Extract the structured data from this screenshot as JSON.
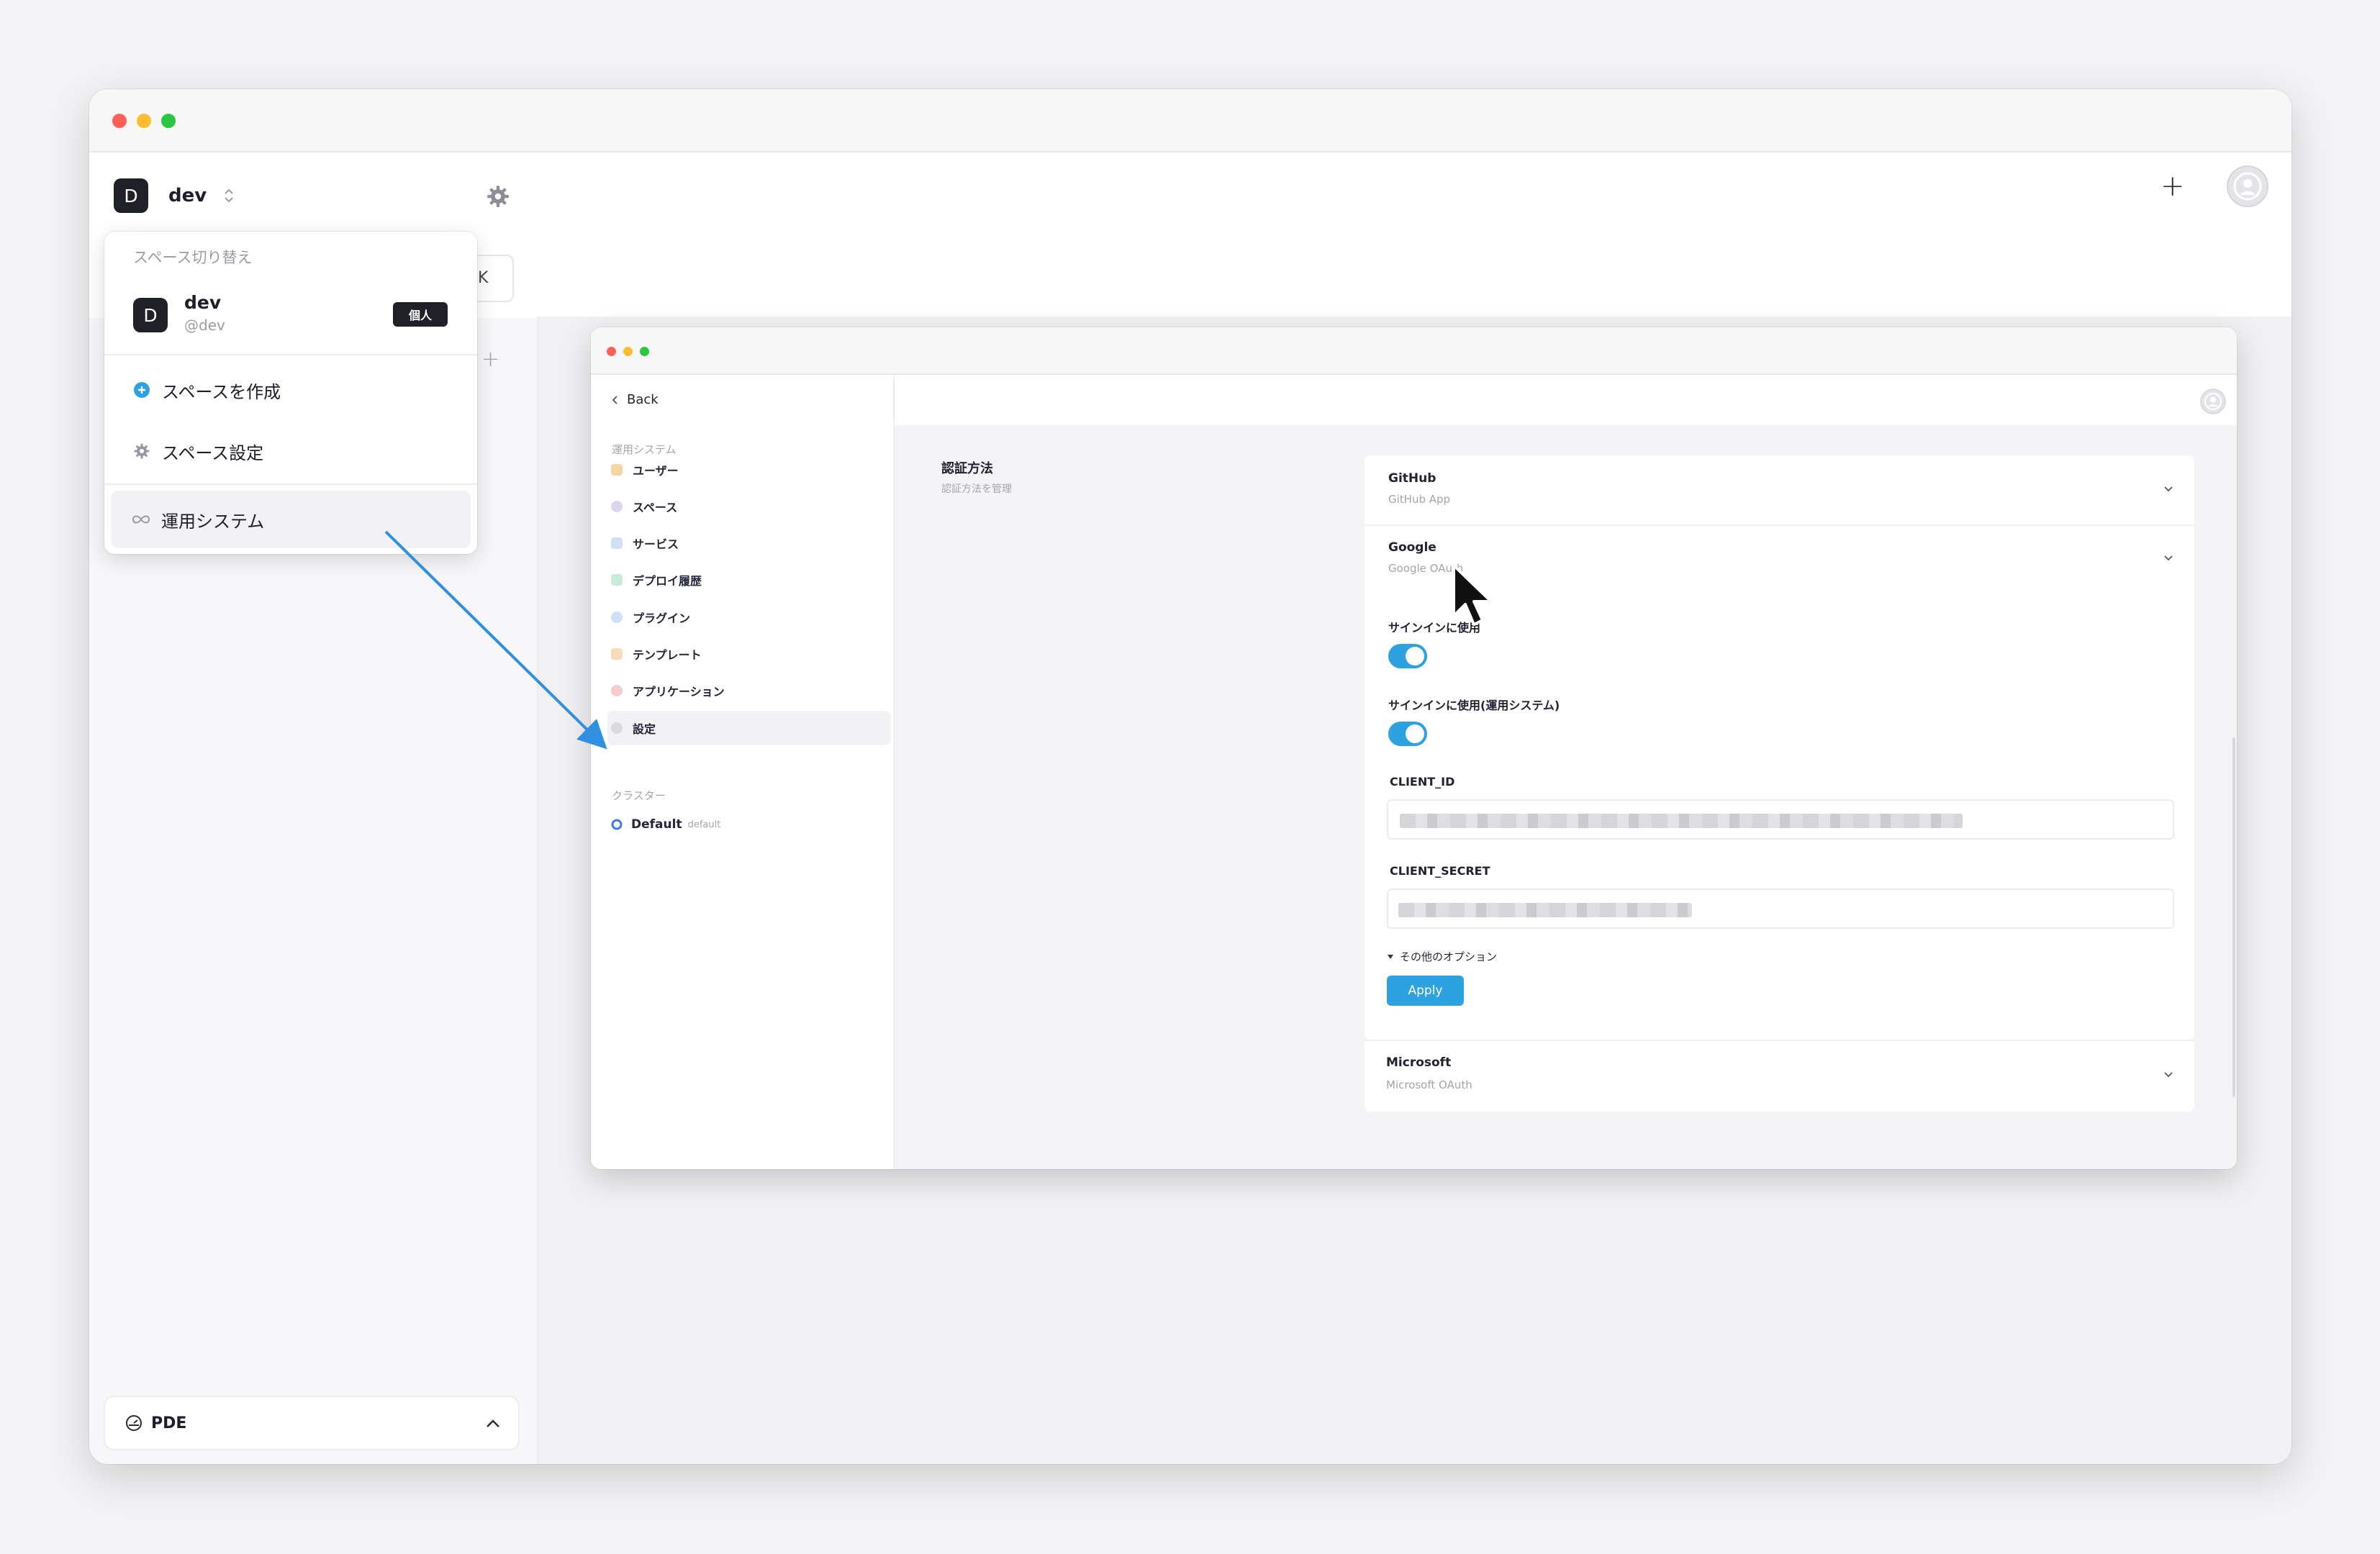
{
  "space_selector": {
    "initial": "D",
    "name": "dev"
  },
  "header": {
    "add_label": "+"
  },
  "sidebar_bg": {
    "partial_label": "K",
    "partial_add": "+"
  },
  "dropdown": {
    "heading": "スペース切り替え",
    "current_space": {
      "initial": "D",
      "name": "dev",
      "handle": "@dev",
      "badge": "個人"
    },
    "items": [
      {
        "label": "スペースを作成",
        "icon": "plus-circle-icon"
      },
      {
        "label": "スペース設定",
        "icon": "gear-icon"
      },
      {
        "label": "運用システム",
        "icon": "infinity-icon"
      }
    ]
  },
  "footer": {
    "label": "PDE"
  },
  "inner": {
    "back_label": "Back",
    "section_ops": "運用システム",
    "nav": [
      {
        "label": "ユーザー",
        "icon": "users-icon",
        "color": "#e8b04a"
      },
      {
        "label": "スペース",
        "icon": "space-icon",
        "color": "#a58fd6"
      },
      {
        "label": "サービス",
        "icon": "service-icon",
        "color": "#4a90e2"
      },
      {
        "label": "デプロイ履歴",
        "icon": "deploy-icon",
        "color": "#4cb782"
      },
      {
        "label": "プラグイン",
        "icon": "plugin-icon",
        "color": "#3c8ce6"
      },
      {
        "label": "テンプレート",
        "icon": "template-icon",
        "color": "#f0a04b"
      },
      {
        "label": "アプリケーション",
        "icon": "application-icon",
        "color": "#e85d5d"
      },
      {
        "label": "設定",
        "icon": "settings-icon",
        "color": "#bdbdc6"
      }
    ],
    "section_cluster": "クラスター",
    "cluster": {
      "name": "Default",
      "tag": "default",
      "color": "#3c7be6"
    },
    "auth": {
      "title": "認証方法",
      "subtitle": "認証方法を管理",
      "providers": [
        {
          "name": "GitHub",
          "type": "GitHub App"
        },
        {
          "name": "Google",
          "type": "Google OAuth"
        },
        {
          "name": "Microsoft",
          "type": "Microsoft OAuth"
        }
      ],
      "signin_label": "サインインに使用",
      "signin_ops_label": "サインインに使用(運用システム)",
      "signin_enabled": true,
      "signin_ops_enabled": true,
      "client_id_label": "CLIENT_ID",
      "client_secret_label": "CLIENT_SECRET",
      "other_options": "その他のオプション",
      "apply": "Apply"
    }
  },
  "colors": {
    "accent": "#2ea2e0",
    "arrow": "#2f8fe0",
    "traffic_red": "#ff5f57",
    "traffic_yellow": "#febc2e",
    "traffic_green": "#28c840"
  }
}
